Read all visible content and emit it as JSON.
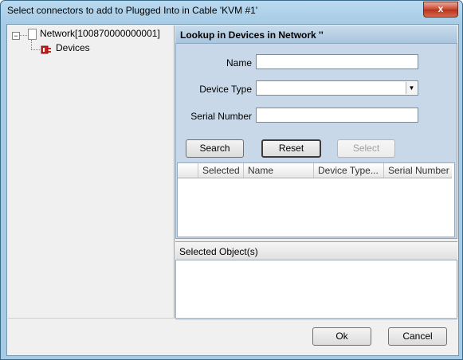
{
  "window": {
    "title": "Select connectors to add to Plugged Into in Cable 'KVM #1'",
    "close_glyph": "x"
  },
  "tree": {
    "expander_glyph": "−",
    "root_label": "Network[100870000000001]",
    "child_label": "Devices"
  },
  "lookup": {
    "header": "Lookup in Devices in Network ''",
    "name_label": "Name",
    "name_value": "",
    "device_type_label": "Device Type",
    "device_type_value": "",
    "serial_label": "Serial Number",
    "serial_value": "",
    "search_button": "Search",
    "reset_button": "Reset",
    "select_button": "Select",
    "columns": [
      "Selected",
      "Name",
      "Device Type...",
      "Serial Number"
    ],
    "rows": []
  },
  "selected_objects": {
    "header": "Selected Object(s)"
  },
  "footer": {
    "ok_button": "Ok",
    "cancel_button": "Cancel"
  },
  "colors": {
    "lookup_body": "#c8d8e8",
    "window_frame": "#a6cbe6",
    "close_button": "#c7432a"
  }
}
